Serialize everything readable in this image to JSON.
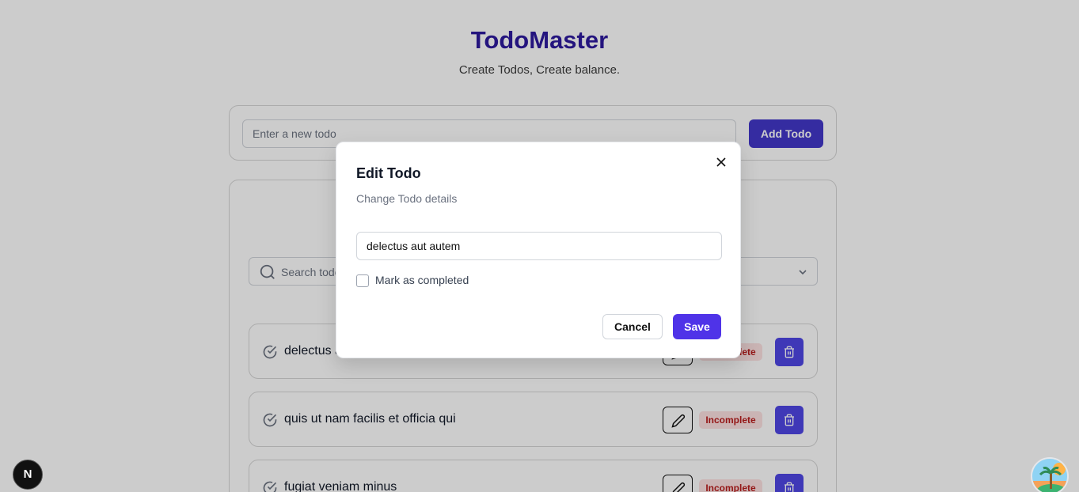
{
  "app": {
    "title": "TodoMaster",
    "subtitle": "Create Todos, Create balance."
  },
  "add_form": {
    "placeholder": "Enter a new todo",
    "button_label": "Add Todo"
  },
  "list": {
    "search_placeholder": "Search todo",
    "rows": [
      {
        "title": "delectus a",
        "status": "Incomplete"
      },
      {
        "title": "quis ut nam facilis et officia qui",
        "status": "Incomplete"
      },
      {
        "title": "fugiat veniam minus",
        "status": "Incomplete"
      }
    ]
  },
  "modal": {
    "title": "Edit Todo",
    "description": "Change Todo details",
    "input_value": "delectus aut autem",
    "checkbox_label": "Mark as completed",
    "checkbox_checked": false,
    "cancel_label": "Cancel",
    "save_label": "Save"
  },
  "badge": {
    "letter": "N"
  },
  "colors": {
    "brand": "#2e1a9e",
    "primary_button": "#4f46e5",
    "save_button": "#4f33e8",
    "incomplete_bg": "#fde2e2",
    "incomplete_text": "#b91c1c"
  }
}
